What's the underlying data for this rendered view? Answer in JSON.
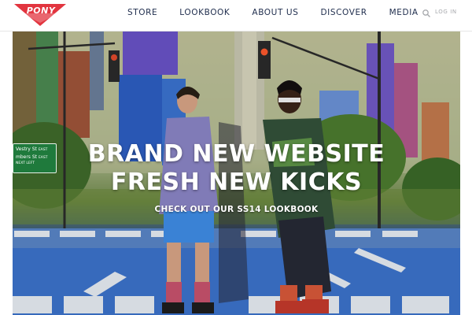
{
  "header": {
    "logo": {
      "text": "PONY",
      "icon": "pony-chevron-logo",
      "color": "#e2353f"
    },
    "nav": [
      {
        "label": "STORE"
      },
      {
        "label": "LOOKBOOK"
      },
      {
        "label": "ABOUT US"
      },
      {
        "label": "DISCOVER"
      },
      {
        "label": "MEDIA"
      }
    ],
    "search_icon": "search-icon",
    "login_label": "LOG IN"
  },
  "hero": {
    "title_line_1": "BRAND NEW WEBSITE",
    "title_line_2": "FRESH NEW KICKS",
    "cta": "CHECK OUT OUR SS14 LOOKBOOK",
    "street_sign": {
      "line_1": "Vestry St",
      "line_1_suffix": "EAST",
      "line_2": "mbers St",
      "line_2_suffix": "EAST",
      "line_3": "NEXT LEFT"
    }
  }
}
